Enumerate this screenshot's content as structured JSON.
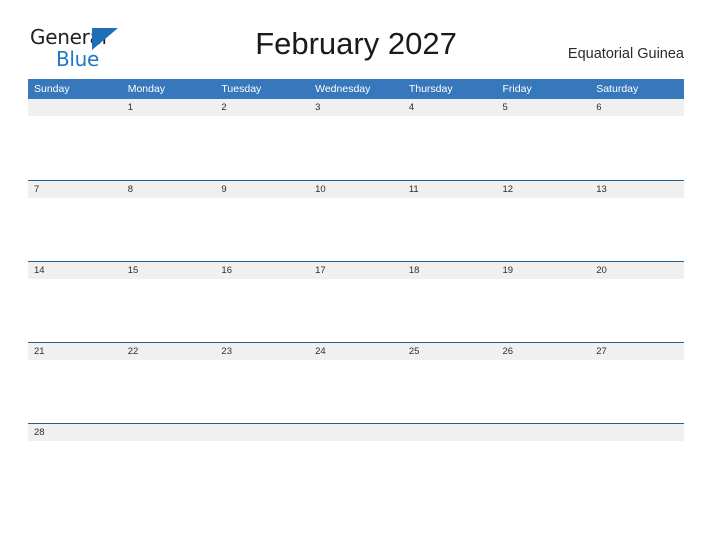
{
  "brand": {
    "name_part1": "General",
    "name_part2": "Blue",
    "triangle_icon": "triangle-icon",
    "colors": {
      "dark": "#231f20",
      "blue": "#1f78c1",
      "triangle": "#1f6fb8"
    }
  },
  "header": {
    "title": "February 2027",
    "country": "Equatorial Guinea"
  },
  "theme": {
    "header_blue": "#3777bc",
    "row_line_blue": "#215f9a",
    "day_band_gray": "#f0f0f0",
    "page_background": "#ffffff"
  },
  "calendar": {
    "month": "February",
    "year": "2027",
    "weekday_headers": [
      "Sunday",
      "Monday",
      "Tuesday",
      "Wednesday",
      "Thursday",
      "Friday",
      "Saturday"
    ],
    "weeks": [
      [
        "",
        "1",
        "2",
        "3",
        "4",
        "5",
        "6"
      ],
      [
        "7",
        "8",
        "9",
        "10",
        "11",
        "12",
        "13"
      ],
      [
        "14",
        "15",
        "16",
        "17",
        "18",
        "19",
        "20"
      ],
      [
        "21",
        "22",
        "23",
        "24",
        "25",
        "26",
        "27"
      ],
      [
        "28",
        "",
        "",
        "",
        "",
        "",
        ""
      ]
    ]
  }
}
